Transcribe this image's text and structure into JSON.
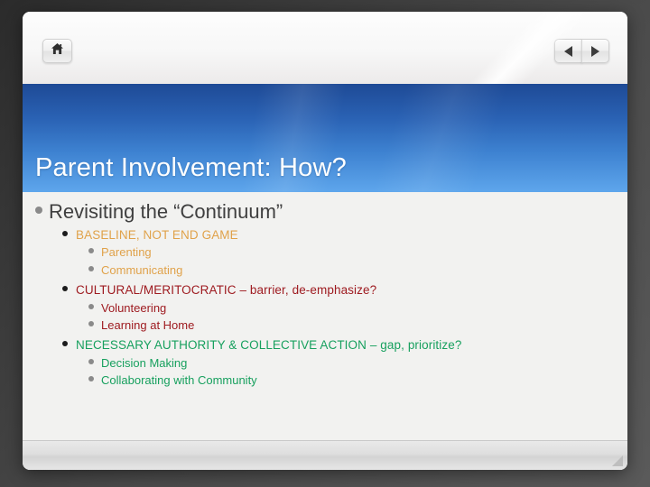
{
  "window": {
    "toolbar": {
      "home_label": "Home",
      "home_icon": "home-icon",
      "prev_label": "Previous slide",
      "prev_icon": "triangle-left-icon",
      "next_label": "Next slide",
      "next_icon": "triangle-right-icon"
    },
    "status_bar": {
      "resize_grip_icon": "resize-grip-icon"
    }
  },
  "slide": {
    "title": "Parent Involvement: How?",
    "heading": "Revisiting the “Continuum”",
    "groups": [
      {
        "heading": "BASELINE, NOT END GAME",
        "items": [
          "Parenting",
          "Communicating"
        ]
      },
      {
        "heading": "CULTURAL/MERITOCRATIC – barrier, de-emphasize?",
        "items": [
          "Volunteering",
          "Learning at Home"
        ]
      },
      {
        "heading": "NECESSARY AUTHORITY & COLLECTIVE ACTION – gap, prioritize?",
        "items": [
          "Decision Making",
          "Collaborating with Community"
        ]
      }
    ]
  },
  "colors": {
    "title_band_top": "#1e4a96",
    "title_band_bottom": "#5ea6ec",
    "title_text": "#ffffff",
    "heading_text": "#3f3f3f",
    "group_1": "#e0a24a",
    "group_2": "#9e1b20",
    "group_3": "#17a05e",
    "slide_background": "#f2f2f0",
    "desktop_background": "#3c3c3c"
  }
}
